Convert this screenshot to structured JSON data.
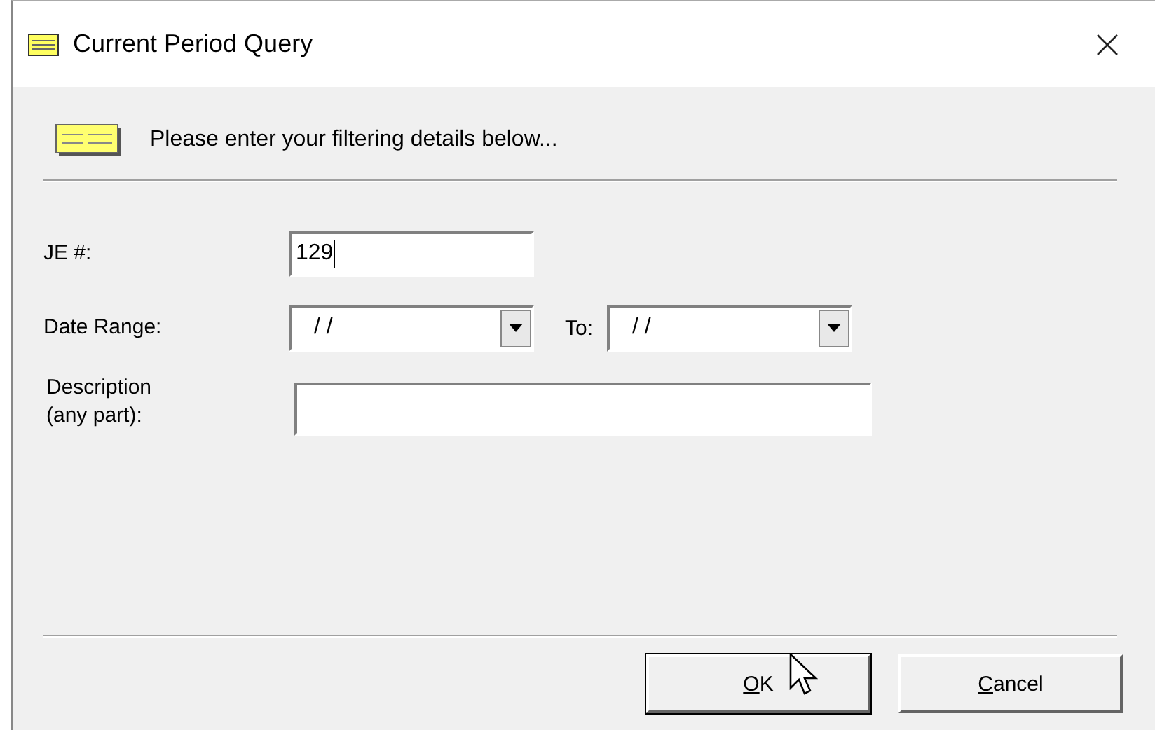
{
  "window": {
    "title": "Current Period Query"
  },
  "header": {
    "text": "Please enter your filtering details below..."
  },
  "fields": [
    {
      "kind": "text",
      "label": "JE #:",
      "value": "129"
    },
    {
      "kind": "date_range",
      "label": "Date Range:",
      "from": "/ /",
      "to_label": "To:",
      "to": "/ /"
    },
    {
      "kind": "wide",
      "label": "Description\n(any part):"
    }
  ],
  "buttons": [
    {
      "accel": "O",
      "rest": "K",
      "default": true
    },
    {
      "accel": "C",
      "rest": "ancel",
      "default": false
    }
  ]
}
